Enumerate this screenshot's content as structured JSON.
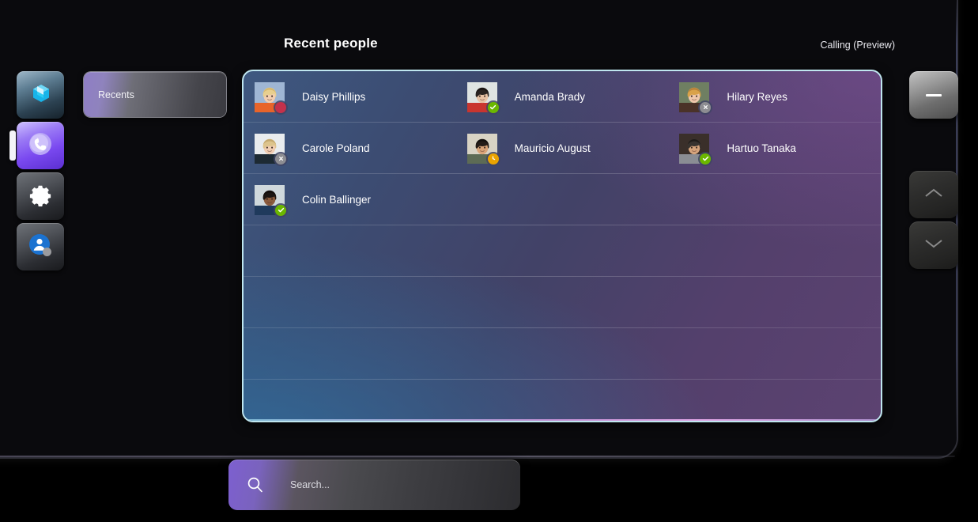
{
  "window": {
    "header_title": "Recent people",
    "header_right_label": "Calling (Preview)"
  },
  "rail": {
    "items": [
      {
        "icon": "teams-app-icon",
        "name": "teams-app",
        "active": false
      },
      {
        "icon": "phone-calls-icon",
        "name": "calls-app",
        "active": true
      },
      {
        "icon": "gear-icon",
        "name": "settings",
        "active": false
      },
      {
        "icon": "person-avatar-icon",
        "name": "account",
        "active": false
      }
    ]
  },
  "tabs": {
    "recents_label": "Recents"
  },
  "people": {
    "rows": [
      [
        {
          "name": "Daisy Phillips",
          "presence": "busy",
          "presence_label": "Busy"
        },
        {
          "name": "Amanda Brady",
          "presence": "available",
          "presence_label": "Available"
        },
        {
          "name": "Hilary Reyes",
          "presence": "offline",
          "presence_label": "Offline"
        }
      ],
      [
        {
          "name": "Carole Poland",
          "presence": "offline",
          "presence_label": "Offline"
        },
        {
          "name": "Mauricio August",
          "presence": "away",
          "presence_label": "Away"
        },
        {
          "name": "Hartuo Tanaka",
          "presence": "available",
          "presence_label": "Available"
        }
      ],
      [
        {
          "name": "Colin Ballinger",
          "presence": "available",
          "presence_label": "Available"
        },
        {
          "name": "",
          "presence": "",
          "presence_label": ""
        },
        {
          "name": "",
          "presence": "",
          "presence_label": ""
        }
      ]
    ]
  },
  "controls": {
    "collapse_label": "collapse-icon",
    "scroll_up_label": "chevron-up-icon",
    "scroll_down_label": "chevron-down-icon"
  },
  "search": {
    "placeholder": "Search...",
    "value": "",
    "icon": "search-icon"
  },
  "colors": {
    "accent_purple": "#7a49f0",
    "panel_border": "#bfe6ef",
    "available": "#6bb700",
    "busy": "#c4314b",
    "away": "#eaa300",
    "offline": "#8d8d92"
  }
}
